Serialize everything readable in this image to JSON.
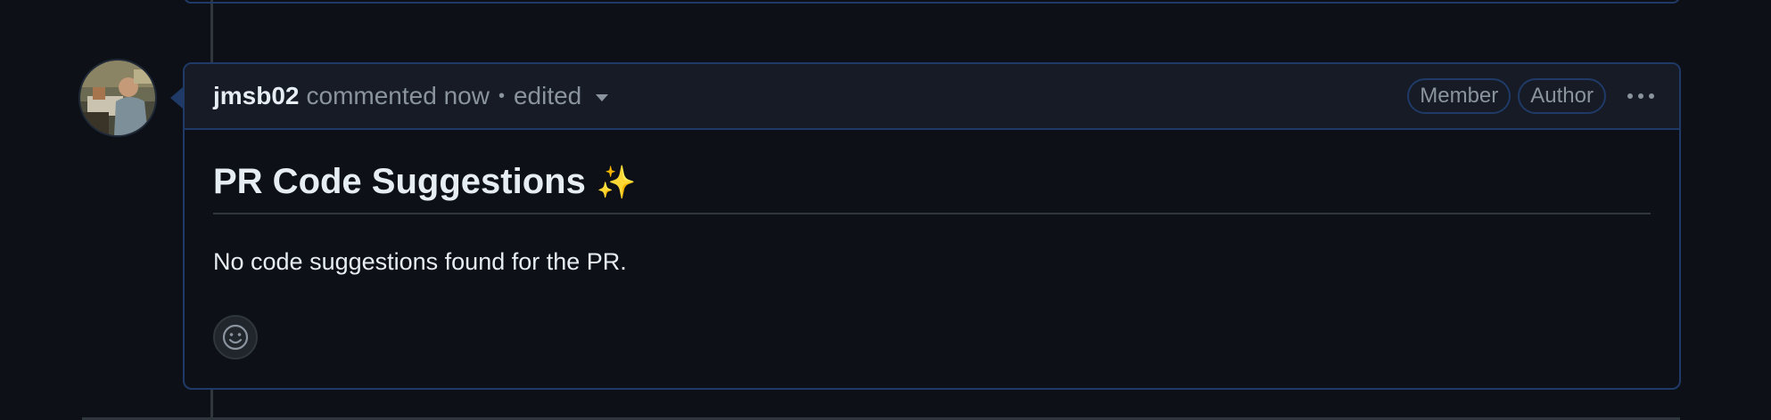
{
  "comment": {
    "author": "jmsb02",
    "action_text": "commented now",
    "separator": "•",
    "edited_label": "edited",
    "badges": [
      "Member",
      "Author"
    ],
    "heading": "PR Code Suggestions",
    "heading_emoji": "✨",
    "body": "No code suggestions found for the PR."
  },
  "icons": {
    "more": "kebab-horizontal-icon",
    "reaction": "smiley-icon",
    "edited_dropdown": "triangle-down-icon"
  },
  "colors": {
    "background": "#0d1117",
    "header_bg": "#161b26",
    "border_accent": "#1f3a66",
    "muted_text": "#8b949e",
    "primary_text": "#e6edf3"
  }
}
